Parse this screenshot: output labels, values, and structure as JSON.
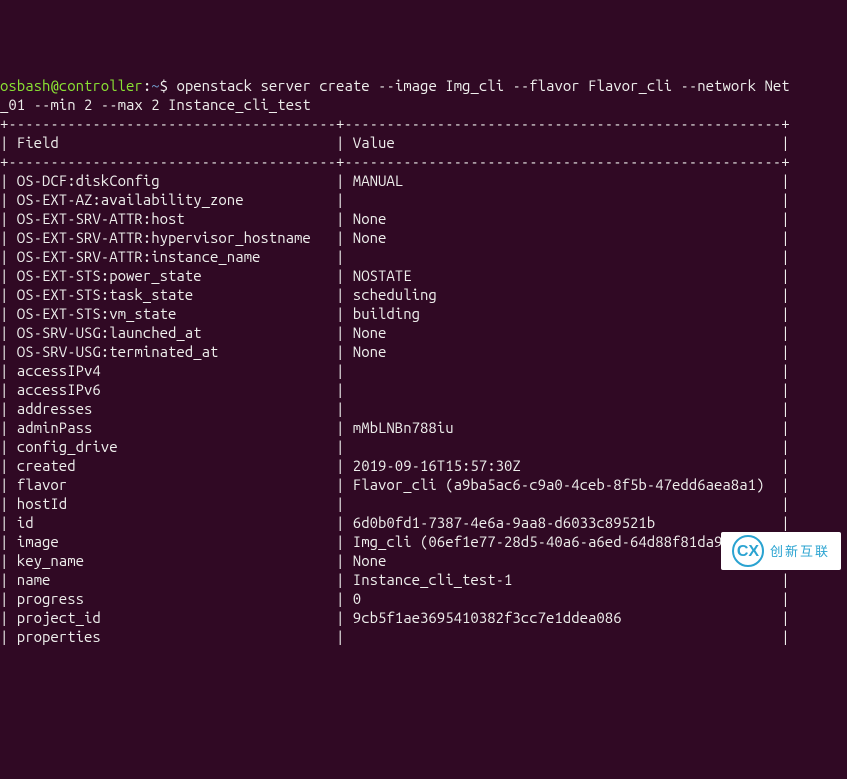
{
  "prompt": {
    "user_host": "osbash@controller",
    "path": "~",
    "symbol": "$"
  },
  "command": "openstack server create --image Img_cli --flavor Flavor_cli --network Net_01 --min 2 --max 2 Instance_cli_test",
  "header": {
    "field": "Field",
    "value": "Value"
  },
  "rows": [
    {
      "field": "OS-DCF:diskConfig",
      "value": "MANUAL"
    },
    {
      "field": "OS-EXT-AZ:availability_zone",
      "value": ""
    },
    {
      "field": "OS-EXT-SRV-ATTR:host",
      "value": "None"
    },
    {
      "field": "OS-EXT-SRV-ATTR:hypervisor_hostname",
      "value": "None"
    },
    {
      "field": "OS-EXT-SRV-ATTR:instance_name",
      "value": ""
    },
    {
      "field": "OS-EXT-STS:power_state",
      "value": "NOSTATE"
    },
    {
      "field": "OS-EXT-STS:task_state",
      "value": "scheduling"
    },
    {
      "field": "OS-EXT-STS:vm_state",
      "value": "building"
    },
    {
      "field": "OS-SRV-USG:launched_at",
      "value": "None"
    },
    {
      "field": "OS-SRV-USG:terminated_at",
      "value": "None"
    },
    {
      "field": "accessIPv4",
      "value": ""
    },
    {
      "field": "accessIPv6",
      "value": ""
    },
    {
      "field": "addresses",
      "value": ""
    },
    {
      "field": "adminPass",
      "value": "mMbLNBn788iu"
    },
    {
      "field": "config_drive",
      "value": ""
    },
    {
      "field": "created",
      "value": "2019-09-16T15:57:30Z"
    },
    {
      "field": "flavor",
      "value": "Flavor_cli (a9ba5ac6-c9a0-4ceb-8f5b-47edd6aea8a1)"
    },
    {
      "field": "hostId",
      "value": ""
    },
    {
      "field": "id",
      "value": "6d0b0fd1-7387-4e6a-9aa8-d6033c89521b"
    },
    {
      "field": "image",
      "value": "Img_cli (06ef1e77-28d5-40a6-a6ed-64d88f81da99)"
    },
    {
      "field": "key_name",
      "value": "None"
    },
    {
      "field": "name",
      "value": "Instance_cli_test-1"
    },
    {
      "field": "progress",
      "value": "0"
    },
    {
      "field": "project_id",
      "value": "9cb5f1ae3695410382f3cc7e1ddea086"
    },
    {
      "field": "properties",
      "value": ""
    }
  ],
  "col_widths": {
    "field": 37,
    "value": 50
  },
  "watermark": {
    "glyph": "CX",
    "text": "创新互联"
  }
}
